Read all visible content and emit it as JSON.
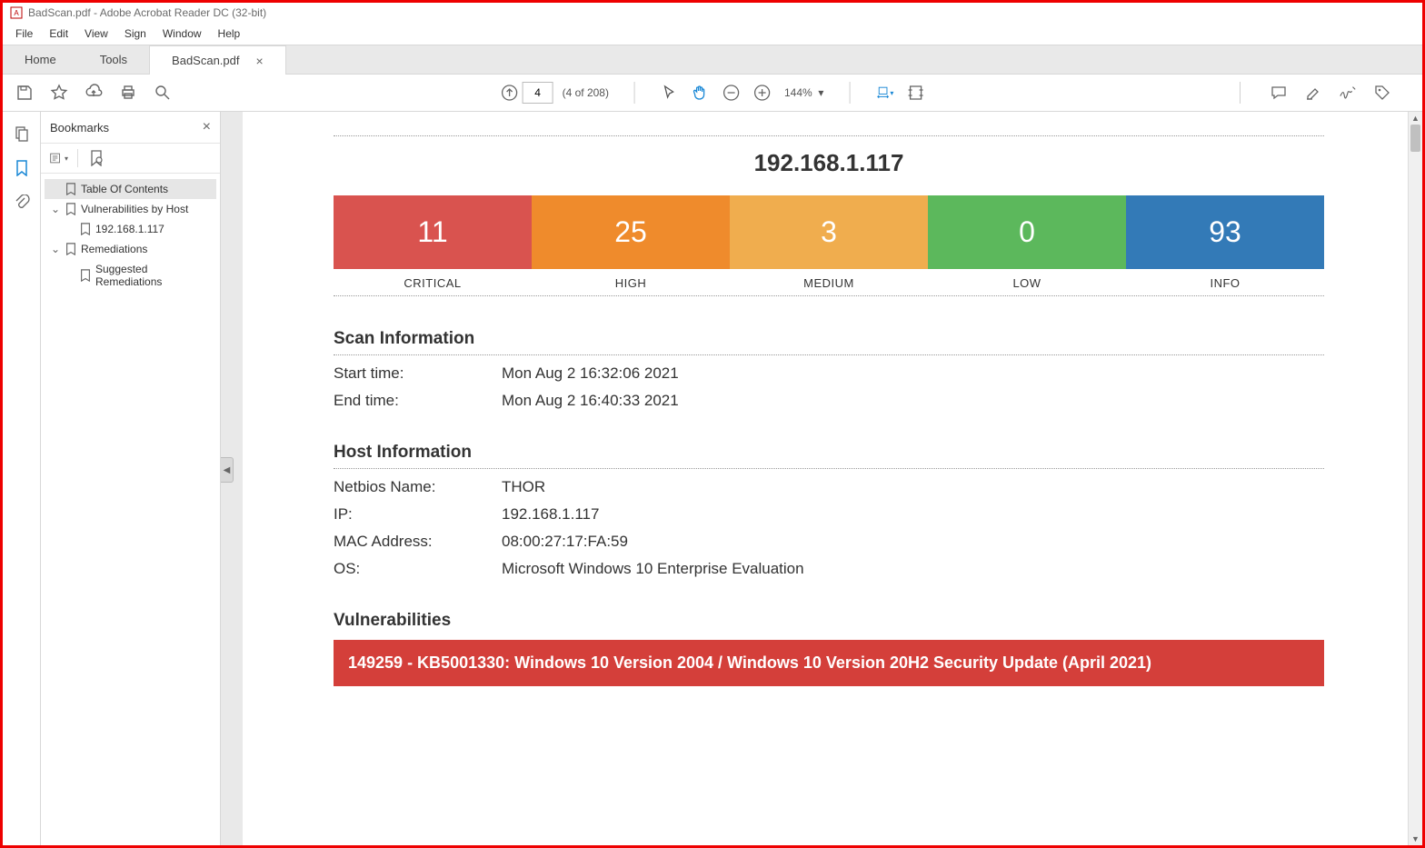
{
  "window": {
    "title": "BadScan.pdf - Adobe Acrobat Reader DC (32-bit)"
  },
  "menu": [
    "File",
    "Edit",
    "View",
    "Sign",
    "Window",
    "Help"
  ],
  "tabs": {
    "home": "Home",
    "tools": "Tools",
    "doc": "BadScan.pdf"
  },
  "toolbar": {
    "page": "4",
    "pagecount": "(4 of 208)",
    "zoom": "144%"
  },
  "nav": {
    "title": "Bookmarks",
    "items": {
      "toc": "Table Of Contents",
      "byhost": "Vulnerabilities by Host",
      "ip": "192.168.1.117",
      "rem": "Remediations",
      "sug": "Suggested Remediations"
    }
  },
  "report": {
    "ip_title": "192.168.1.117",
    "severity": {
      "critical": {
        "count": "11",
        "label": "CRITICAL"
      },
      "high": {
        "count": "25",
        "label": "HIGH"
      },
      "medium": {
        "count": "3",
        "label": "MEDIUM"
      },
      "low": {
        "count": "0",
        "label": "LOW"
      },
      "info": {
        "count": "93",
        "label": "INFO"
      }
    },
    "scan_info": {
      "heading": "Scan Information",
      "start_label": "Start time:",
      "start_value": "Mon Aug 2 16:32:06 2021",
      "end_label": "End time:",
      "end_value": "Mon Aug 2 16:40:33 2021"
    },
    "host_info": {
      "heading": "Host Information",
      "netbios_label": "Netbios Name:",
      "netbios_value": "THOR",
      "ip_label": "IP:",
      "ip_value": "192.168.1.117",
      "mac_label": "MAC Address:",
      "mac_value": "08:00:27:17:FA:59",
      "os_label": "OS:",
      "os_value": "Microsoft Windows 10 Enterprise Evaluation"
    },
    "vulns": {
      "heading": "Vulnerabilities",
      "first": "149259 - KB5001330: Windows 10 Version 2004 / Windows 10 Version 20H2 Security Update (April 2021)"
    }
  }
}
